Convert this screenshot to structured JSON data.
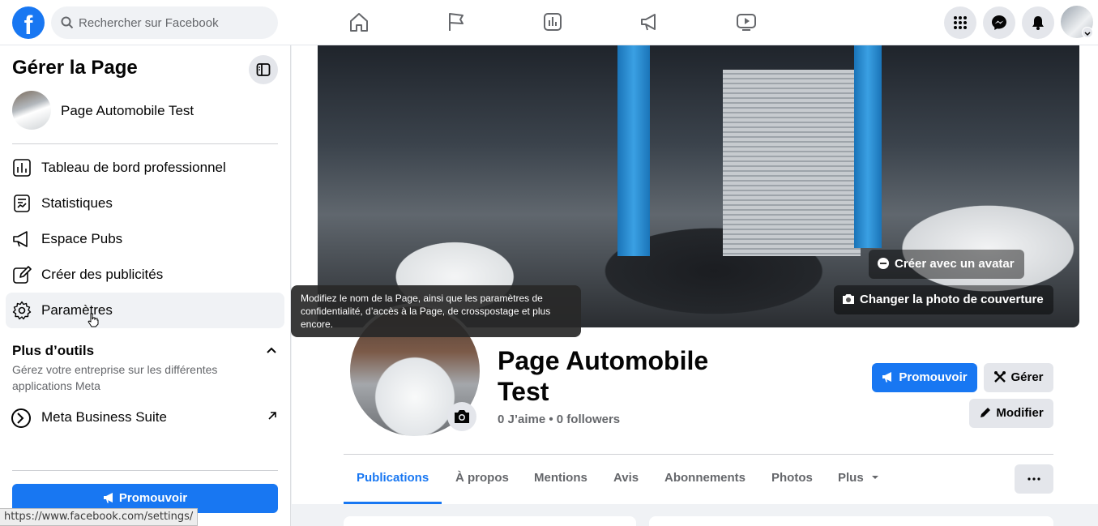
{
  "topbar": {
    "logo": "f",
    "search_placeholder": "Rechercher sur Facebook",
    "nav_icons": [
      "home-icon",
      "flag-icon",
      "chart-icon",
      "megaphone-icon",
      "video-icon"
    ],
    "right_icons": [
      "apps-grid-icon",
      "messenger-icon",
      "bell-icon"
    ]
  },
  "sidebar": {
    "title": "Gérer la Page",
    "page_name": "Page Automobile Test",
    "items": [
      {
        "label": "Tableau de bord professionnel",
        "icon": "dashboard-icon"
      },
      {
        "label": "Statistiques",
        "icon": "stats-icon"
      },
      {
        "label": "Espace Pubs",
        "icon": "megaphone-icon"
      },
      {
        "label": "Créer des publicités",
        "icon": "pencil-icon"
      },
      {
        "label": "Paramètres",
        "icon": "gear-icon",
        "active": true
      }
    ],
    "more_tools_title": "Plus d’outils",
    "more_tools_desc": "Gérez votre entreprise sur les différentes applications Meta",
    "meta_business_suite": "Meta Business Suite",
    "promote_label": "Promouvoir"
  },
  "cover": {
    "avatar_button": "Créer avec un avatar",
    "change_cover_button": "Changer la photo de couverture"
  },
  "page": {
    "title": "Page Automobile Test",
    "stats": "0 J’aime • 0 followers",
    "promote_label": "Promouvoir",
    "manage_label": "Gérer",
    "edit_label": "Modifier"
  },
  "tabs": [
    "Publications",
    "À propos",
    "Mentions",
    "Avis",
    "Abonnements",
    "Photos",
    "Plus"
  ],
  "active_tab": "Publications",
  "tooltip": "Modifiez le nom de la Page, ainsi que les paramètres de confidentialité, d’accès à la Page, de crosspostage et plus encore.",
  "status_url": "https://www.facebook.com/settings/",
  "colors": {
    "accent": "#1877f2",
    "background": "#f0f2f5"
  }
}
